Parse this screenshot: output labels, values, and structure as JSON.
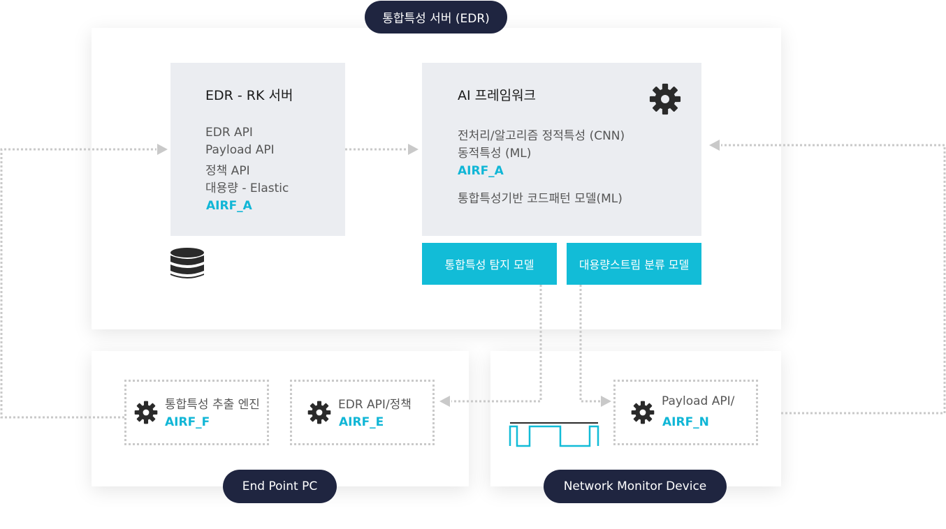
{
  "top_pill": "통합특성 서버 (EDR)",
  "edr_box": {
    "title": "EDR - RK 서버",
    "lines": [
      "EDR API",
      "Payload API",
      "정책 API",
      "대용량 - Elastic"
    ],
    "tag": "AIRF_A"
  },
  "ai_box": {
    "title": "AI 프레임워크",
    "lines": [
      "전처리/알고리즘 정적특성 (CNN)",
      "동적특성 (ML)"
    ],
    "tag": "AIRF_A",
    "line_after": "통합특성기반 코드패턴 모델(ML)"
  },
  "model_boxes": [
    "통합특성 탐지 모델",
    "대용량스트림 분류 모델"
  ],
  "endpoint": {
    "engine_label": "통합특성 추출 엔진",
    "engine_tag": "AIRF_F",
    "api_label": "EDR API/정책",
    "api_tag": "AIRF_E",
    "pill": "End Point PC"
  },
  "network": {
    "payload_label": "Payload API/",
    "payload_tag": "AIRF_N",
    "pill": "Network Monitor Device"
  },
  "colors": {
    "navy": "#1f2540",
    "cyan": "#12bcd7",
    "gray_box": "#ebedf1",
    "dotted": "#c9c9c9"
  },
  "icons": [
    "gear-icon",
    "database-icon",
    "signal-wave-icon"
  ]
}
